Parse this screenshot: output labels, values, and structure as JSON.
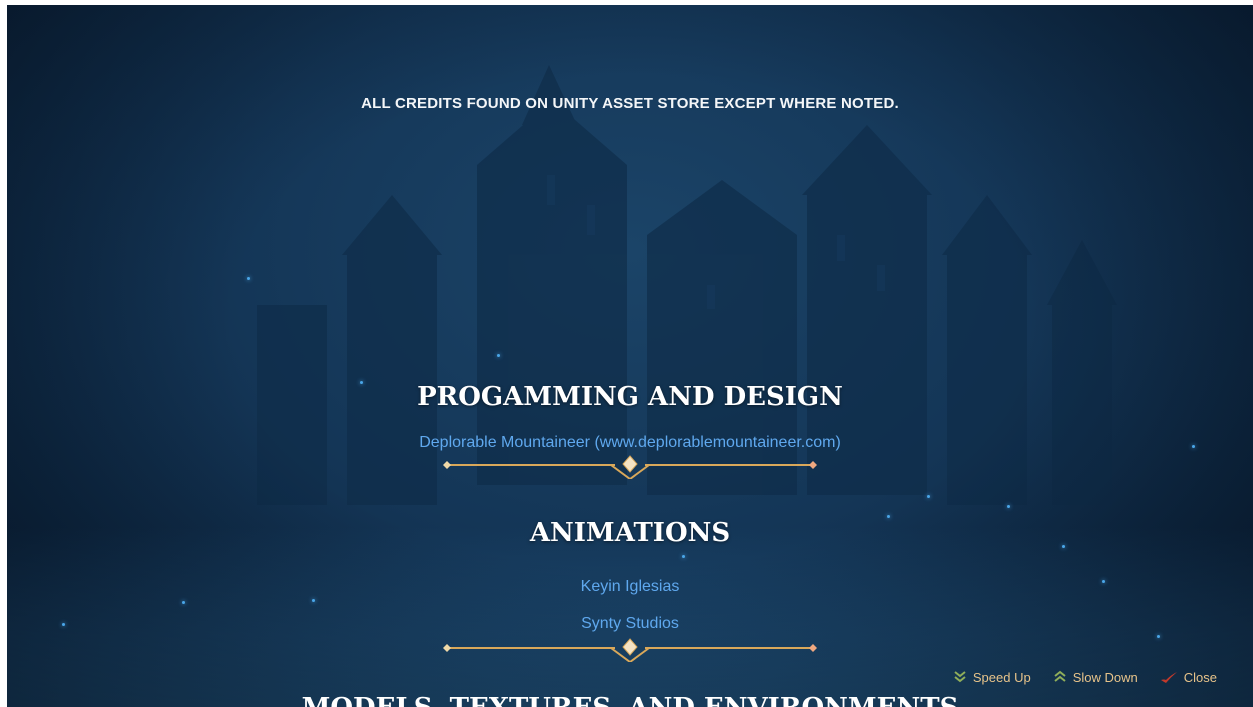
{
  "notice": "ALL CREDITS FOUND ON UNITY ASSET STORE EXCEPT WHERE NOTED.",
  "sections": [
    {
      "title": "PROGAMMING AND DESIGN",
      "credits": [
        "Deplorable Mountaineer (www.deplorablemountaineer.com)"
      ]
    },
    {
      "title": "ANIMATIONS",
      "credits": [
        "Keyin Iglesias",
        "Synty Studios"
      ]
    },
    {
      "title": "MODELS, TEXTURES, AND ENVIRONMENTS",
      "credits": []
    }
  ],
  "controls": {
    "speed_up": {
      "label": "Speed Up",
      "icon": "double-chevron-down-icon"
    },
    "slow_down": {
      "label": "Slow Down",
      "icon": "double-chevron-up-icon"
    },
    "close": {
      "label": "Close",
      "icon": "check-mark-icon"
    }
  },
  "colors": {
    "title": "#ffffff",
    "credit": "#5fa8ee",
    "control_label": "#e7c38a",
    "divider_gold": "#d9a85a",
    "close_icon": "#c0392b"
  }
}
